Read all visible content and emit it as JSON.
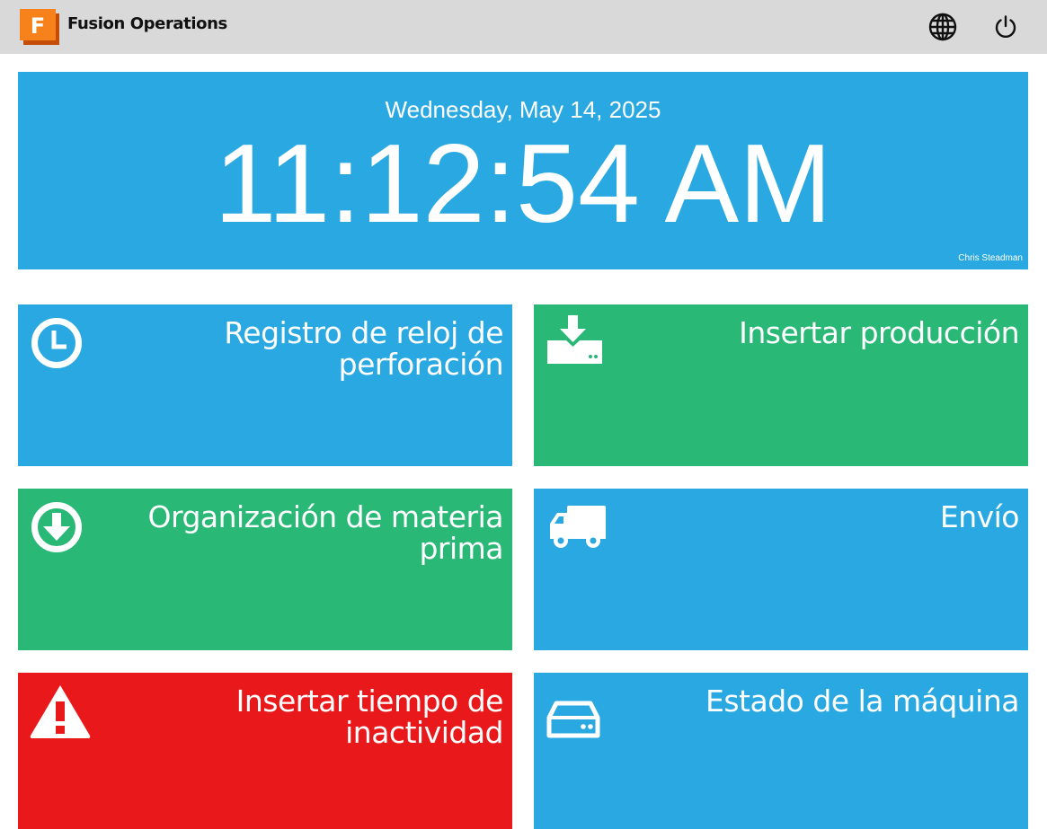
{
  "header": {
    "app_title": "Fusion Operations",
    "logo_letter": "F",
    "logo_colors": {
      "front": "#f7821b",
      "back": "#c44d0a"
    },
    "background": "#d9d9d9",
    "icons": {
      "language": "globe-icon",
      "power": "power-icon"
    }
  },
  "clock": {
    "date": "Wednesday, May 14, 2025",
    "time": "11:12:54 AM",
    "user": "Chris Steadman",
    "background": "#29a8e2"
  },
  "tiles": [
    {
      "label": "Registro de reloj de perforación",
      "icon": "clock-icon",
      "color": "#29a8e2"
    },
    {
      "label": "Insertar producción",
      "icon": "download-tray-icon",
      "color": "#2ab877"
    },
    {
      "label": "Organización de materia prima",
      "icon": "arrow-down-circle-icon",
      "color": "#2ab877"
    },
    {
      "label": "Envío",
      "icon": "truck-icon",
      "color": "#29a8e2"
    },
    {
      "label": "Insertar tiempo de inactividad",
      "icon": "warning-triangle-icon",
      "color": "#e9191b"
    },
    {
      "label": "Estado de la máquina",
      "icon": "hard-drive-icon",
      "color": "#29a8e2"
    }
  ]
}
